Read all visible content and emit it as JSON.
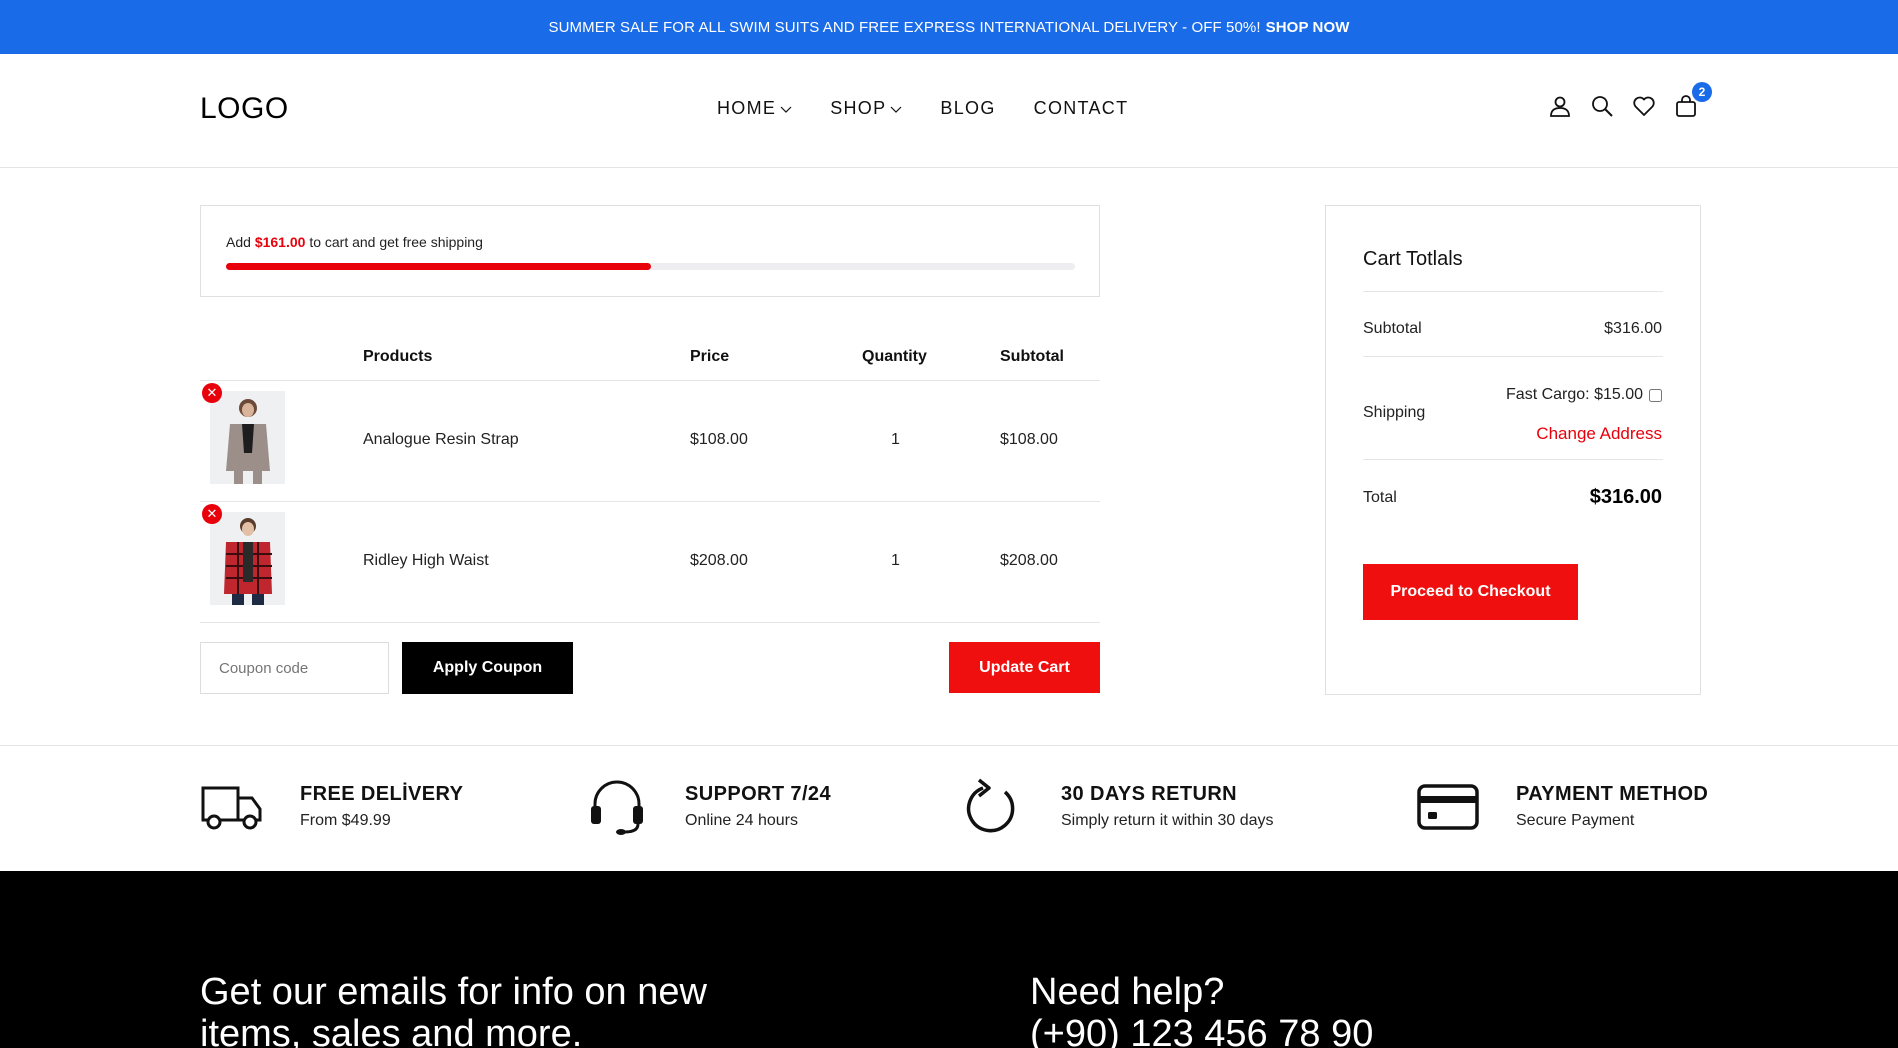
{
  "topbar": {
    "text": "SUMMER SALE FOR ALL SWIM SUITS AND FREE EXPRESS INTERNATIONAL DELIVERY - OFF 50%!",
    "cta": "SHOP NOW"
  },
  "header": {
    "logo": "LOGO",
    "nav": [
      "HOME",
      "SHOP",
      "BLOG",
      "CONTACT"
    ],
    "cart_count": "2"
  },
  "shipping_progress": {
    "prefix": "Add",
    "amount": "$161.00",
    "suffix": "to cart and get free shipping",
    "progress_fraction": 0.5
  },
  "cart": {
    "headers": {
      "products": "Products",
      "price": "Price",
      "quantity": "Quantity",
      "subtotal": "Subtotal"
    },
    "items": [
      {
        "name": "Analogue Resin Strap",
        "price": "$108.00",
        "quantity": "1",
        "subtotal": "$108.00"
      },
      {
        "name": "Ridley High Waist",
        "price": "$208.00",
        "quantity": "1",
        "subtotal": "$208.00"
      }
    ],
    "coupon_placeholder": "Coupon code",
    "apply_coupon": "Apply Coupon",
    "update_cart": "Update Cart"
  },
  "totals": {
    "title": "Cart Totlals",
    "subtotal_label": "Subtotal",
    "subtotal_value": "$316.00",
    "shipping_label": "Shipping",
    "shipping_option": "Fast Cargo: $15.00",
    "change_address": "Change Address",
    "total_label": "Total",
    "total_value": "$316.00",
    "checkout": "Proceed to Checkout"
  },
  "features": [
    {
      "title": "FREE DELİVERY",
      "subtitle": "From $49.99",
      "icon": "truck-icon"
    },
    {
      "title": "SUPPORT 7/24",
      "subtitle": "Online 24 hours",
      "icon": "headset-icon"
    },
    {
      "title": "30 DAYS RETURN",
      "subtitle": "Simply return it within 30 days",
      "icon": "refresh-icon"
    },
    {
      "title": "PAYMENT METHOD",
      "subtitle": "Secure Payment",
      "icon": "credit-card-icon"
    }
  ],
  "footer": {
    "newsletter_heading": "Get our emails for info on new items, sales and more.",
    "help_heading": "Need help?",
    "phone": "(+90) 123 456 78 90"
  },
  "colors": {
    "accent_blue": "#1a6be8",
    "accent_red": "#e8000b",
    "black": "#000000"
  }
}
